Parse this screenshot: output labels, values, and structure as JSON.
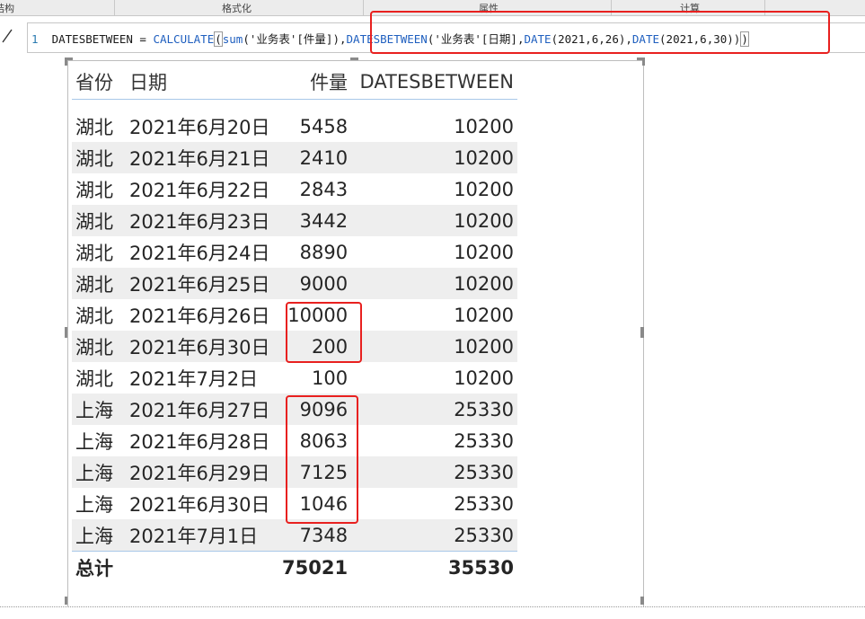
{
  "ribbon": {
    "structure_label": "结构",
    "format_label": "格式化",
    "properties_label": "属性",
    "calc_label": "计算"
  },
  "formula": {
    "line_number": "1",
    "measure_name": "DATESBETWEEN",
    "equals": " = ",
    "fn_calculate": "CALCULATE",
    "paren_open": "(",
    "fn_sum": "sum",
    "sum_arg": "('业务表'[件量])",
    "comma": ",",
    "fn_datesbetween": "DATESBETWEEN",
    "db_arg": "('业务表'[日期],",
    "fn_date1": "DATE",
    "date1_arg": "(2021,6,26),",
    "fn_date2": "DATE",
    "date2_arg": "(2021,6,30))",
    "paren_close": ")"
  },
  "table": {
    "headers": [
      "省份",
      "日期",
      "件量",
      "DATESBETWEEN"
    ],
    "rows": [
      [
        "湖北",
        "2021年6月20日",
        "5458",
        "10200"
      ],
      [
        "湖北",
        "2021年6月21日",
        "2410",
        "10200"
      ],
      [
        "湖北",
        "2021年6月22日",
        "2843",
        "10200"
      ],
      [
        "湖北",
        "2021年6月23日",
        "3442",
        "10200"
      ],
      [
        "湖北",
        "2021年6月24日",
        "8890",
        "10200"
      ],
      [
        "湖北",
        "2021年6月25日",
        "9000",
        "10200"
      ],
      [
        "湖北",
        "2021年6月26日",
        "10000",
        "10200"
      ],
      [
        "湖北",
        "2021年6月30日",
        "200",
        "10200"
      ],
      [
        "湖北",
        "2021年7月2日",
        "100",
        "10200"
      ],
      [
        "上海",
        "2021年6月27日",
        "9096",
        "25330"
      ],
      [
        "上海",
        "2021年6月28日",
        "8063",
        "25330"
      ],
      [
        "上海",
        "2021年6月29日",
        "7125",
        "25330"
      ],
      [
        "上海",
        "2021年6月30日",
        "1046",
        "25330"
      ],
      [
        "上海",
        "2021年7月1日",
        "7348",
        "25330"
      ]
    ],
    "total": {
      "label": "总计",
      "qty": "75021",
      "measure": "35530"
    }
  },
  "colors": {
    "highlight": "#e8201f",
    "function_blue": "#1f5fbf",
    "row_stripe": "#eeeeee",
    "header_rule": "#a8c8e8"
  }
}
